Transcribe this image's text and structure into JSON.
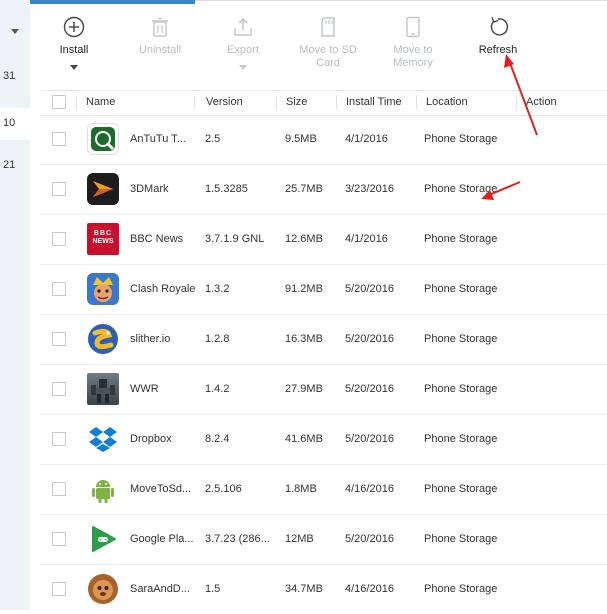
{
  "side": {
    "numbers": [
      "31",
      "10",
      "21"
    ]
  },
  "toolbar": {
    "install": "Install",
    "uninstall": "Uninstall",
    "export": "Export",
    "move_sd": [
      "Move to SD",
      "Card"
    ],
    "move_memory": [
      "Move to",
      "Memory"
    ],
    "refresh": "Refresh"
  },
  "columns": {
    "name": "Name",
    "version": "Version",
    "size": "Size",
    "install_time": "Install Time",
    "location": "Location",
    "action": "Action"
  },
  "colors": {
    "accent": "#3b86c8",
    "arrow": "#e0201b"
  },
  "apps": [
    {
      "name": "AnTuTu T...",
      "version": "2.5",
      "size": "9.5MB",
      "time": "4/1/2016",
      "location": "Phone Storage",
      "icon": "antutu-icon"
    },
    {
      "name": "3DMark",
      "version": "1.5.3285",
      "size": "25.7MB",
      "time": "3/23/2016",
      "location": "Phone Storage",
      "icon": "3dmark-icon"
    },
    {
      "name": "BBC News",
      "version": "3.7.1.9 GNL",
      "size": "12.6MB",
      "time": "4/1/2016",
      "location": "Phone Storage",
      "icon": "bbc-news-icon",
      "icon_text": [
        "BBC",
        "NEWS"
      ]
    },
    {
      "name": "Clash Royale",
      "version": "1.3.2",
      "size": "91.2MB",
      "time": "5/20/2016",
      "location": "Phone Storage",
      "icon": "clash-royale-icon"
    },
    {
      "name": "slither.io",
      "version": "1.2.8",
      "size": "16.3MB",
      "time": "5/20/2016",
      "location": "Phone Storage",
      "icon": "slither-icon"
    },
    {
      "name": "WWR",
      "version": "1.4.2",
      "size": "27.9MB",
      "time": "5/20/2016",
      "location": "Phone Storage",
      "icon": "wwr-icon"
    },
    {
      "name": "Dropbox",
      "version": "8.2.4",
      "size": "41.6MB",
      "time": "5/20/2016",
      "location": "Phone Storage",
      "icon": "dropbox-icon"
    },
    {
      "name": "MoveToSd...",
      "version": "2.5.106",
      "size": "1.8MB",
      "time": "4/16/2016",
      "location": "Phone Storage",
      "icon": "android-icon"
    },
    {
      "name": "Google Pla...",
      "version": "3.7.23 (286...",
      "size": "12MB",
      "time": "5/20/2016",
      "location": "Phone Storage",
      "icon": "google-play-games-icon"
    },
    {
      "name": "SaraAndD...",
      "version": "1.5",
      "size": "34.7MB",
      "time": "4/16/2016",
      "location": "Phone Storage",
      "icon": "sara-icon"
    }
  ]
}
